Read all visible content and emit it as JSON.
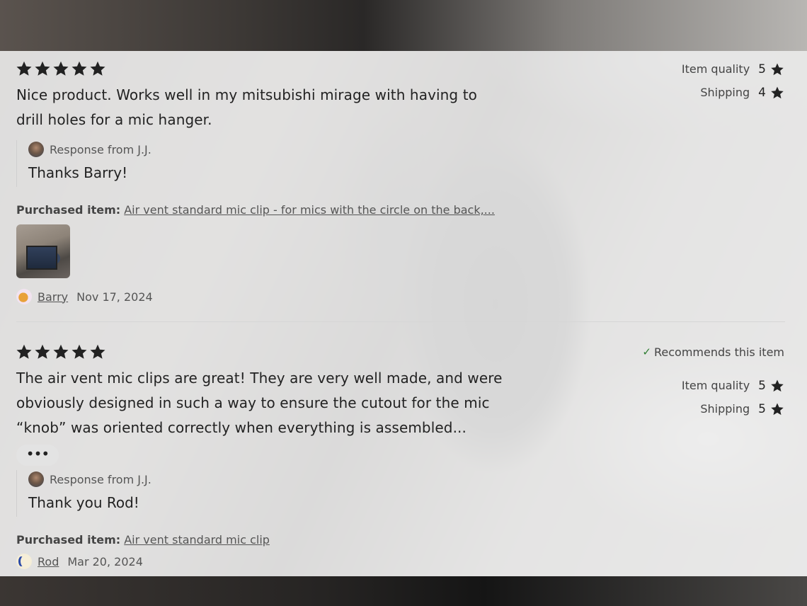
{
  "reviews": [
    {
      "stars": 5,
      "text_line1": "Nice product. Works well in my mitsubishi mirage with having to",
      "text_line2": "drill holes for a mic hanger.",
      "recommends": null,
      "ratings": [
        {
          "label": "Item quality",
          "value": "5"
        },
        {
          "label": "Shipping",
          "value": "4"
        }
      ],
      "response": {
        "from": "Response from J.J.",
        "text": "Thanks Barry!"
      },
      "purchased_label": "Purchased item:",
      "purchased_item": "Air vent standard mic clip - for mics with the circle on the back,...",
      "author": "Barry",
      "date": "Nov 17, 2024"
    },
    {
      "stars": 5,
      "text_line1": "The air vent mic clips are great! They are very well made, and were",
      "text_line2": "obviously designed in such a way to ensure the cutout for the mic",
      "text_line3": "“knob” was oriented correctly when everything is assembled...",
      "more_label": "•••",
      "recommends": "Recommends this item",
      "ratings": [
        {
          "label": "Item quality",
          "value": "5"
        },
        {
          "label": "Shipping",
          "value": "5"
        }
      ],
      "response": {
        "from": "Response from J.J.",
        "text": "Thank you Rod!"
      },
      "purchased_label": "Purchased item:",
      "purchased_item": "Air vent standard mic clip",
      "author": "Rod",
      "date": "Mar 20, 2024"
    }
  ],
  "icons": {
    "star": "star-icon",
    "check": "check-icon"
  },
  "colors": {
    "star": "#222222",
    "check": "#2e7d32"
  }
}
